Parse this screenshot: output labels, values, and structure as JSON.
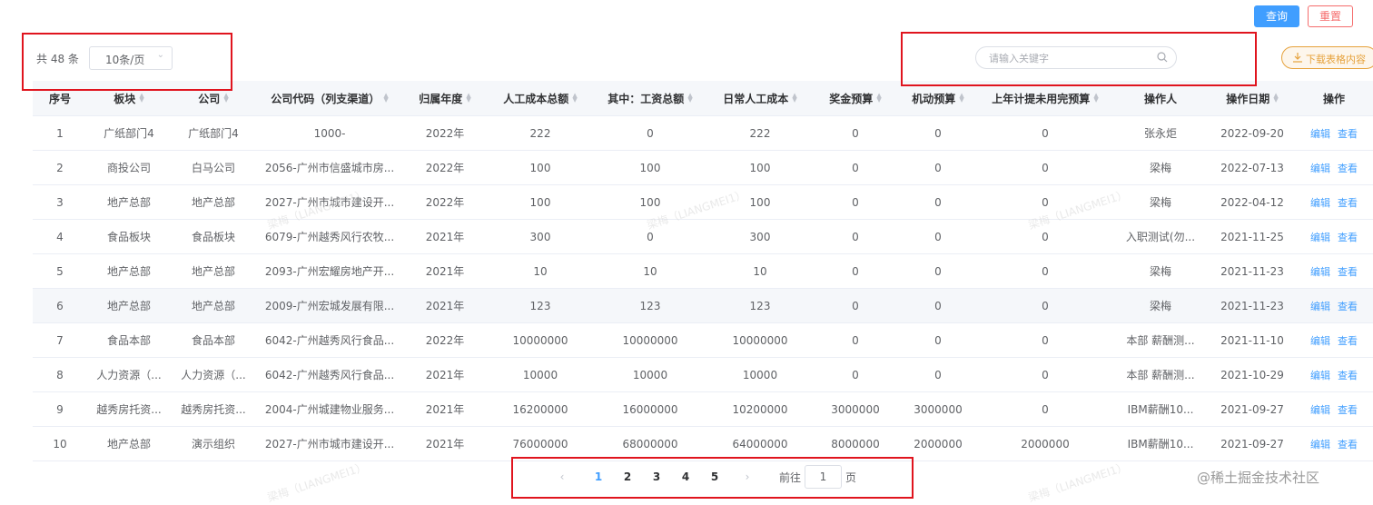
{
  "toolbar": {
    "query_label": "查询",
    "reset_label": "重置"
  },
  "list": {
    "total_text": "共 48 条",
    "page_size": "10条/页",
    "search_placeholder": "请输入关键字",
    "download_label": "下载表格内容"
  },
  "table": {
    "columns": [
      "序号",
      "板块",
      "公司",
      "公司代码（列支渠道）",
      "归属年度",
      "人工成本总额",
      "其中：工资总额",
      "日常人工成本",
      "奖金预算",
      "机动预算",
      "上年计提未用完预算",
      "操作人",
      "操作日期",
      "操作"
    ],
    "edit_label": "编辑",
    "view_label": "查看",
    "rows": [
      [
        "1",
        "广纸部门4",
        "广纸部门4",
        "1000-",
        "2022年",
        "222",
        "0",
        "222",
        "0",
        "0",
        "0",
        "张永炬",
        "2022-09-20"
      ],
      [
        "2",
        "商投公司",
        "白马公司",
        "2056-广州市信盛城市房...",
        "2022年",
        "100",
        "100",
        "100",
        "0",
        "0",
        "0",
        "梁梅",
        "2022-07-13"
      ],
      [
        "3",
        "地产总部",
        "地产总部",
        "2027-广州市城市建设开...",
        "2022年",
        "100",
        "100",
        "100",
        "0",
        "0",
        "0",
        "梁梅",
        "2022-04-12"
      ],
      [
        "4",
        "食品板块",
        "食品板块",
        "6079-广州越秀风行农牧...",
        "2021年",
        "300",
        "0",
        "300",
        "0",
        "0",
        "0",
        "入职测试(勿...",
        "2021-11-25"
      ],
      [
        "5",
        "地产总部",
        "地产总部",
        "2093-广州宏耀房地产开...",
        "2021年",
        "10",
        "10",
        "10",
        "0",
        "0",
        "0",
        "梁梅",
        "2021-11-23"
      ],
      [
        "6",
        "地产总部",
        "地产总部",
        "2009-广州宏城发展有限...",
        "2021年",
        "123",
        "123",
        "123",
        "0",
        "0",
        "0",
        "梁梅",
        "2021-11-23"
      ],
      [
        "7",
        "食品本部",
        "食品本部",
        "6042-广州越秀风行食品...",
        "2022年",
        "10000000",
        "10000000",
        "10000000",
        "0",
        "0",
        "0",
        "本部 薪酬测...",
        "2021-11-10"
      ],
      [
        "8",
        "人力资源（...",
        "人力资源（...",
        "6042-广州越秀风行食品...",
        "2021年",
        "10000",
        "10000",
        "10000",
        "0",
        "0",
        "0",
        "本部 薪酬测...",
        "2021-10-29"
      ],
      [
        "9",
        "越秀房托资...",
        "越秀房托资...",
        "2004-广州城建物业服务...",
        "2021年",
        "16200000",
        "16000000",
        "10200000",
        "3000000",
        "3000000",
        "0",
        "IBM薪酬10...",
        "2021-09-27"
      ],
      [
        "10",
        "地产总部",
        "演示组织",
        "2027-广州市城市建设开...",
        "2021年",
        "76000000",
        "68000000",
        "64000000",
        "8000000",
        "2000000",
        "2000000",
        "IBM薪酬10...",
        "2021-09-27"
      ]
    ]
  },
  "pagination": {
    "pages": [
      "1",
      "2",
      "3",
      "4",
      "5"
    ],
    "current": "1",
    "goto_label": "前往",
    "goto_value": "1",
    "goto_unit": "页"
  },
  "watermark": {
    "text": "梁梅（LIANGMEI1）",
    "footer": "@稀土掘金技术社区"
  }
}
